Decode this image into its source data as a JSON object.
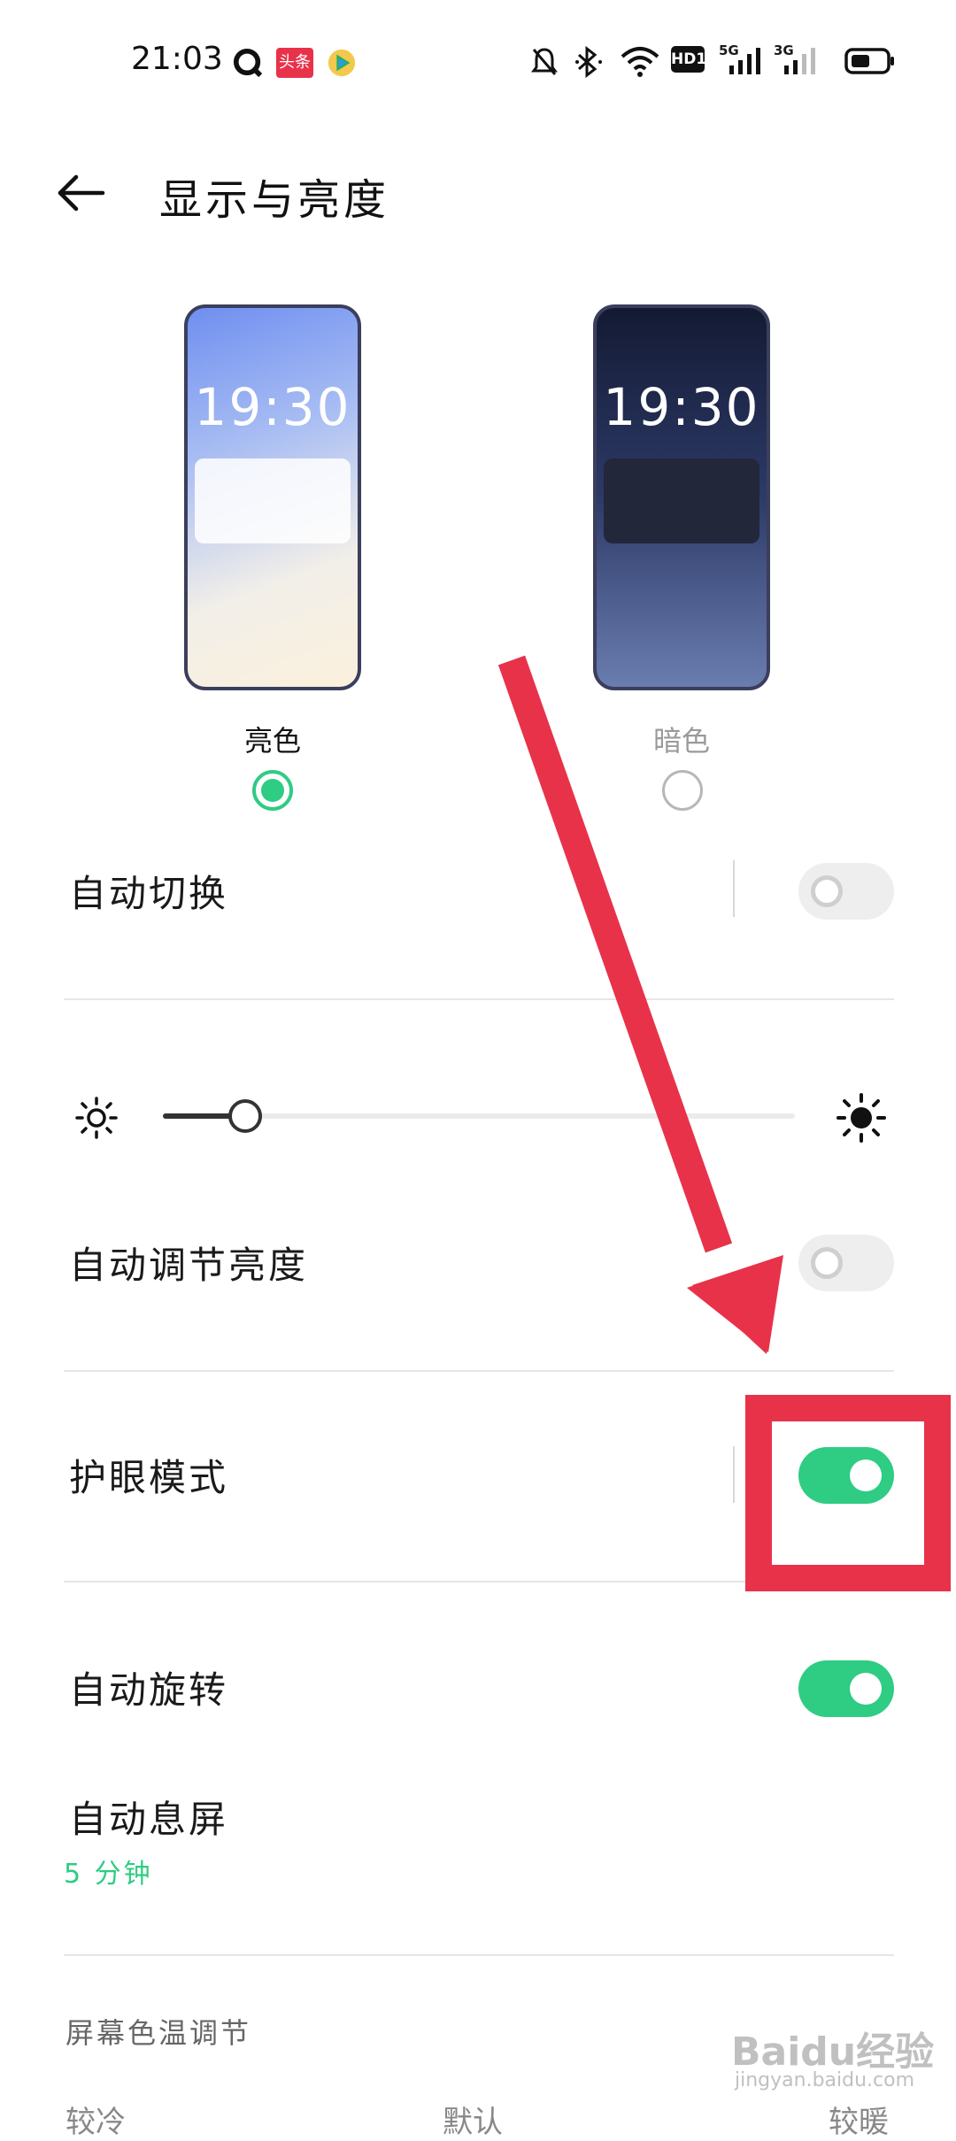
{
  "status_bar": {
    "time": "21:03",
    "app_badge_text": "头条",
    "hd_label": "HD1",
    "signal1_label": "5G",
    "signal2_label": "3G",
    "icons": [
      "q-app-icon",
      "toutiao-icon",
      "video-app-icon",
      "mute-icon",
      "bluetooth-icon",
      "wifi-icon",
      "hd-icon",
      "signal-5g-icon",
      "signal-3g-icon",
      "battery-icon"
    ]
  },
  "header": {
    "title": "显示与亮度",
    "back_icon": "arrow-left-icon"
  },
  "theme": {
    "light": {
      "preview_time": "19:30",
      "label": "亮色",
      "selected": true
    },
    "dark": {
      "preview_time": "19:30",
      "label": "暗色",
      "selected": false
    }
  },
  "rows": {
    "auto_switch": {
      "label": "自动切换",
      "on": false
    },
    "auto_brightness": {
      "label": "自动调节亮度",
      "on": false
    },
    "eye_protection": {
      "label": "护眼模式",
      "on": true
    },
    "auto_rotate": {
      "label": "自动旋转",
      "on": true
    },
    "auto_screen_off": {
      "label": "自动息屏",
      "value": "5 分钟"
    }
  },
  "brightness": {
    "level": 0.13,
    "icons": [
      "brightness-low-icon",
      "brightness-high-icon"
    ]
  },
  "color_temperature": {
    "section_label": "屏幕色温调节",
    "options": [
      "较冷",
      "默认",
      "较暖"
    ]
  },
  "colors": {
    "accent_green": "#2fcc83",
    "annotation_red": "#e8324a"
  },
  "watermark": {
    "text": "Baidu经验",
    "sub": "jingyan.baidu.com"
  }
}
